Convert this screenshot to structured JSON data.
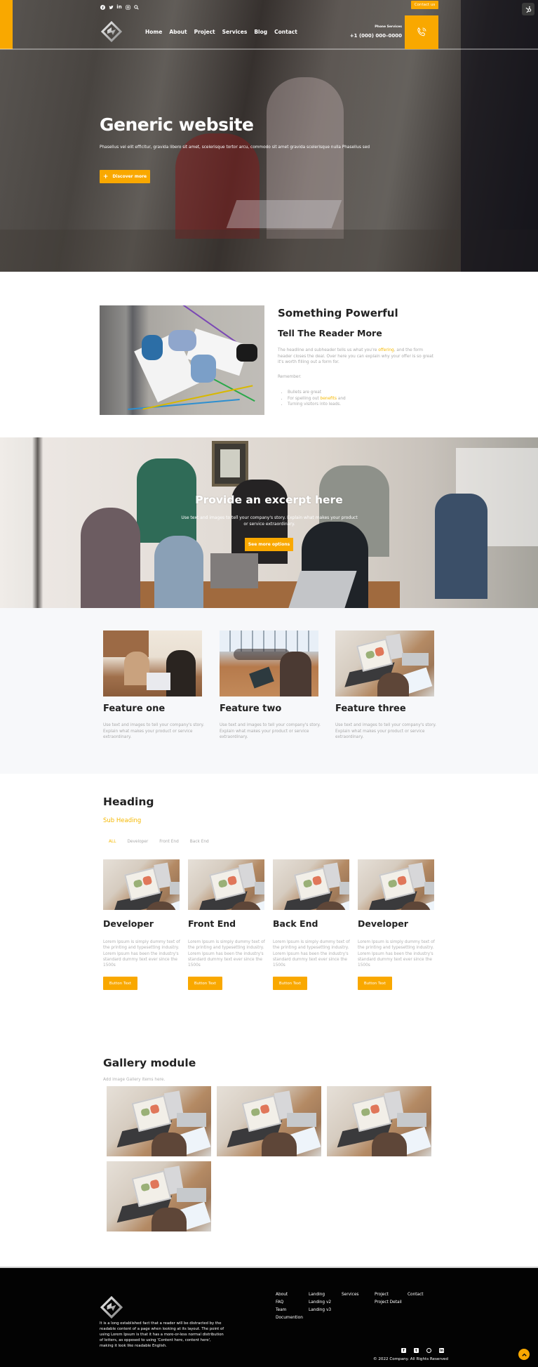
{
  "colors": {
    "accent": "#f9a800",
    "highlight": "#f5b800",
    "footer_bg": "#030303",
    "muted_text": "#a9a9a9"
  },
  "header": {
    "social_icons": [
      "facebook-icon",
      "twitter-icon",
      "linkedin-icon",
      "instagram-icon",
      "search-icon"
    ],
    "contact_button": "Contact us",
    "nav": [
      "Home",
      "About",
      "Project",
      "Services",
      "Blog",
      "Contact"
    ],
    "phone_label": "Phone Services",
    "phone_number": "+1 (000) 000–0000"
  },
  "hero": {
    "title": "Generic website",
    "subtitle": "Phasellus vel elit efficitur, gravida libero sit amet, scelerisque tortor arcu, commodo sit amet gravida scelerisque nulla Phasellus sed",
    "button_icon": "+",
    "button_label": "Discover more"
  },
  "intro": {
    "title": "Something Powerful",
    "subtitle": "Tell The Reader More",
    "body_before": "The headline and subheader tells us what you're ",
    "body_highlight": "offering",
    "body_after": ", and the form header closes the deal. Over here you can explain why your offer is so great it's worth filling out a form for.",
    "remember": "Remember:",
    "bullets": [
      {
        "text": "Bullets are great",
        "highlight": "",
        "after": ""
      },
      {
        "text": "For spelling out ",
        "highlight": "benefits",
        "after": " and"
      },
      {
        "text": "Turning visitors into leads.",
        "highlight": "",
        "after": ""
      }
    ]
  },
  "excerpt": {
    "title": "Provide an excerpt here",
    "body": "Use text and images to tell your company's story. Explain what makes your product or service extraordinary.",
    "button": "See more options"
  },
  "features": [
    {
      "title": "Feature one",
      "body": "Use text and images to tell your company's story. Explain what makes your product or service extraordinary."
    },
    {
      "title": "Feature two",
      "body": "Use text and images to tell your company's story. Explain what makes your product or service extraordinary."
    },
    {
      "title": "Feature three",
      "body": "Use text and images to tell your company's story. Explain what makes your product or service extraordinary."
    }
  ],
  "portfolio": {
    "heading": "Heading",
    "subheading": "Sub Heading",
    "filters": [
      "ALL",
      "Developer",
      "Front End",
      "Back End"
    ],
    "active_filter": "ALL",
    "cards": [
      {
        "title": "Developer",
        "body": "Lorem Ipsum is simply dummy text of the printing and typesetting industry. Lorem Ipsum has been the industry's standard dummy text ever since the 1500s",
        "button": "Button Text"
      },
      {
        "title": "Front End",
        "body": "Lorem Ipsum is simply dummy text of the printing and typesetting industry. Lorem Ipsum has been the industry's standard dummy text ever since the 1500s",
        "button": "Button Text"
      },
      {
        "title": "Back End",
        "body": "Lorem Ipsum is simply dummy text of the printing and typesetting industry. Lorem Ipsum has been the industry's standard dummy text ever since the 1500s",
        "button": "Button Text"
      },
      {
        "title": "Developer",
        "body": "Lorem Ipsum is simply dummy text of the printing and typesetting industry. Lorem Ipsum has been the industry's standard dummy text ever since the 1500s",
        "button": "Button Text"
      }
    ]
  },
  "gallery": {
    "heading": "Gallery module",
    "subheading": "Add image Gallery items here.",
    "item_count": 4
  },
  "footer": {
    "description": "It is a long established fact that a reader will be distracted by the readable content of a page when looking at its layout. The point of using Lorem Ipsum is that it has a more-or-less normal distribution of letters, as opposed to using 'Content here, content here', making it look like readable English.",
    "columns": [
      [
        "About",
        "FAQ",
        "Team",
        "Documention"
      ],
      [
        "Landing",
        "Landing v2",
        "Landing v3"
      ],
      [
        "Services"
      ],
      [
        "Project",
        "Project Detail"
      ],
      [
        "Contact"
      ]
    ],
    "social_icons": [
      "facebook-icon",
      "twitter-icon",
      "instagram-icon",
      "linkedin-icon"
    ],
    "copyright": "© 2022 Company. All Rights Reserved"
  }
}
